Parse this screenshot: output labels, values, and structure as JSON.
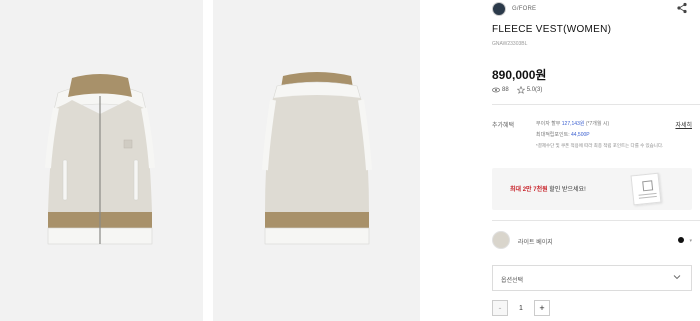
{
  "brand": {
    "name": "G/FORE"
  },
  "product": {
    "title": "FLEECE VEST(WOMEN)",
    "code": "GNAW23303BL",
    "price": "890,000원",
    "likes": "88",
    "rating": "5.0(3)"
  },
  "benefits": {
    "label": "추가혜택",
    "installment_prefix": "무이자 할부 ",
    "installment_amount": "127,143원",
    "installment_suffix": " (*7개월 시)",
    "points_prefix": "최대적립포인트: ",
    "points_amount": "44,500P",
    "detail_link": "자세히",
    "note": "*결제수단 및 쿠폰 적용에 따라 최종 적립 포인트는 다를 수 있습니다."
  },
  "coupon": {
    "highlight": "최대 2만 7천원",
    "text": " 할인 받으세요!"
  },
  "color_option": {
    "name": "라이트 베이지",
    "swatch_color": "#d9d5cc"
  },
  "option_select": {
    "placeholder": "옵션선택"
  },
  "quantity": {
    "value": "1",
    "minus": "-",
    "plus": "+"
  }
}
